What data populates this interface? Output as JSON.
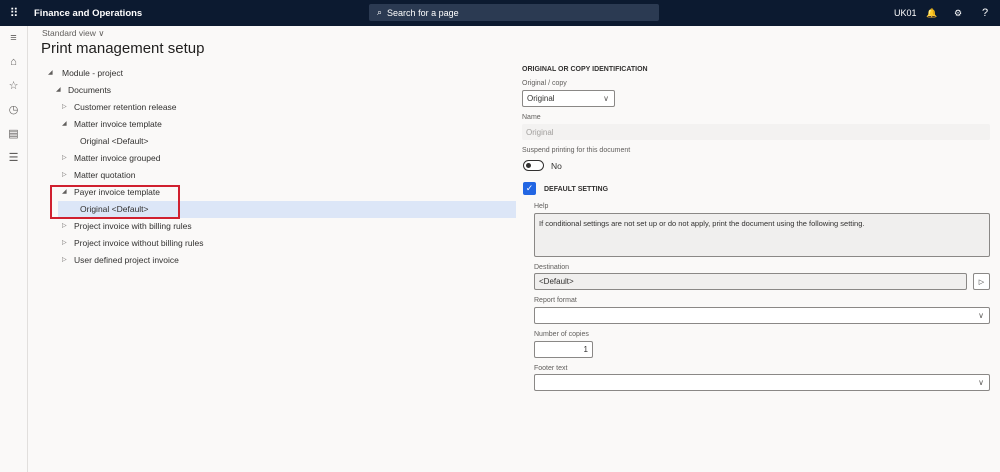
{
  "topbar": {
    "app_name": "Finance and Operations",
    "search_placeholder": "Search for a page",
    "company": "UK01",
    "bell": "🔔",
    "gear": "⚙",
    "help": "?"
  },
  "nav": {
    "icons": [
      "hamburger-icon",
      "home-icon",
      "star-icon",
      "clock-icon",
      "workspace-icon",
      "list-icon"
    ]
  },
  "view": "Standard view ∨",
  "title": "Print management setup",
  "tree": [
    {
      "label": "Module - project",
      "level": 0,
      "state": "expanded"
    },
    {
      "label": "Documents",
      "level": 1,
      "state": "expanded"
    },
    {
      "label": "Customer retention release",
      "level": 2,
      "state": "collapsed"
    },
    {
      "label": "Matter invoice template",
      "level": 2,
      "state": "expanded"
    },
    {
      "label": "Original <Default>",
      "level": 3,
      "state": "leaf"
    },
    {
      "label": "Matter invoice grouped",
      "level": 2,
      "state": "collapsed"
    },
    {
      "label": "Matter quotation",
      "level": 2,
      "state": "collapsed"
    },
    {
      "label": "Payer invoice template",
      "level": 2,
      "state": "expanded"
    },
    {
      "label": "Original <Default>",
      "level": 3,
      "state": "leaf",
      "selected": true
    },
    {
      "label": "Project invoice with billing rules",
      "level": 2,
      "state": "collapsed"
    },
    {
      "label": "Project invoice without billing rules",
      "level": 2,
      "state": "collapsed"
    },
    {
      "label": "User defined project invoice",
      "level": 2,
      "state": "collapsed"
    }
  ],
  "form": {
    "section": "ORIGINAL OR COPY IDENTIFICATION",
    "orig_label": "Original / copy",
    "orig_value": "Original",
    "name_label": "Name",
    "name_value": "Original",
    "suspend_label": "Suspend printing for this document",
    "suspend_value": "No",
    "default_label": "DEFAULT SETTING",
    "default_checked": true,
    "help_label": "Help",
    "help_text": "If conditional settings are not set up or do not apply, print the document using the following setting.",
    "dest_label": "Destination",
    "dest_value": "<Default>",
    "format_label": "Report format",
    "format_value": "",
    "copies_label": "Number of copies",
    "copies_value": "1",
    "footer_label": "Footer text",
    "footer_value": ""
  },
  "colors": {
    "topbar": "#0c1a30",
    "selected": "#dce6f7",
    "highlight": "#d0202f",
    "accent": "#2266e3"
  }
}
